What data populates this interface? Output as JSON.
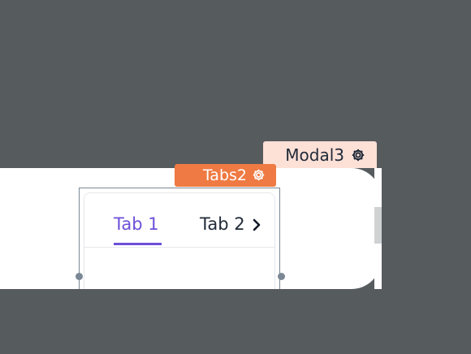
{
  "modal_label": {
    "text": "Modal3",
    "icon": "gear-icon"
  },
  "tabs_label": {
    "text": "Tabs2",
    "icon": "gear-icon"
  },
  "tabs": [
    {
      "label": "Tab 1",
      "active": true
    },
    {
      "label": "Tab 2",
      "active": false
    }
  ],
  "tab_scroll_icon": "chevron-right-icon",
  "colors": {
    "canvas_bg": "#565b5e",
    "modal_label_bg": "#fde0d6",
    "tabs_label_bg": "#ef7a43",
    "active_tab": "#6d4fd8",
    "selection_outline": "#7b8794"
  }
}
